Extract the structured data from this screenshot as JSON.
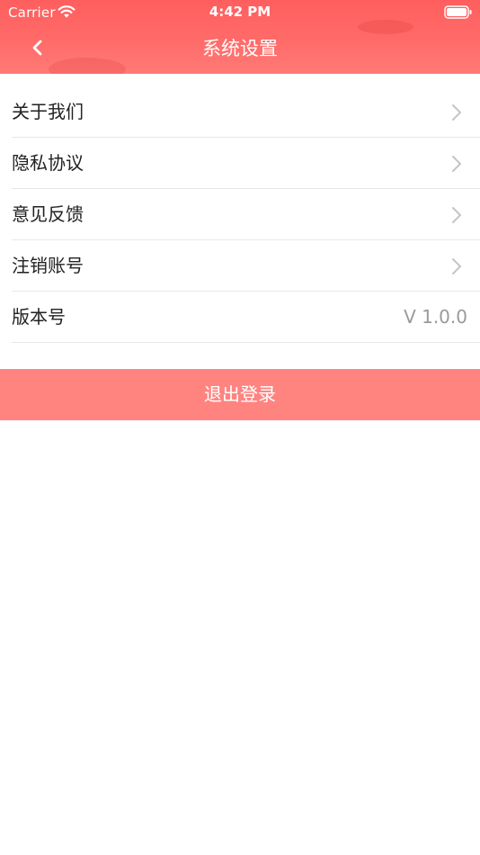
{
  "status_bar": {
    "carrier": "Carrier",
    "time": "4:42 PM",
    "icons": [
      "wifi-icon",
      "battery-icon"
    ]
  },
  "nav": {
    "title": "系统设置",
    "back_icon": "chevron-left-icon"
  },
  "settings": {
    "items": [
      {
        "label": "关于我们",
        "icon": "chevron-right-icon"
      },
      {
        "label": "隐私协议",
        "icon": "chevron-right-icon"
      },
      {
        "label": "意见反馈",
        "icon": "chevron-right-icon"
      },
      {
        "label": "注销账号",
        "icon": "chevron-right-icon"
      }
    ],
    "version": {
      "label": "版本号",
      "value": "V 1.0.0"
    }
  },
  "logout": {
    "label": "退出登录"
  },
  "colors": {
    "header": "#ff6565",
    "logout_button": "#ff8480",
    "divider": "#e8e8e8",
    "chevron": "#c4c4c4",
    "value_text": "#9a9a9a"
  }
}
